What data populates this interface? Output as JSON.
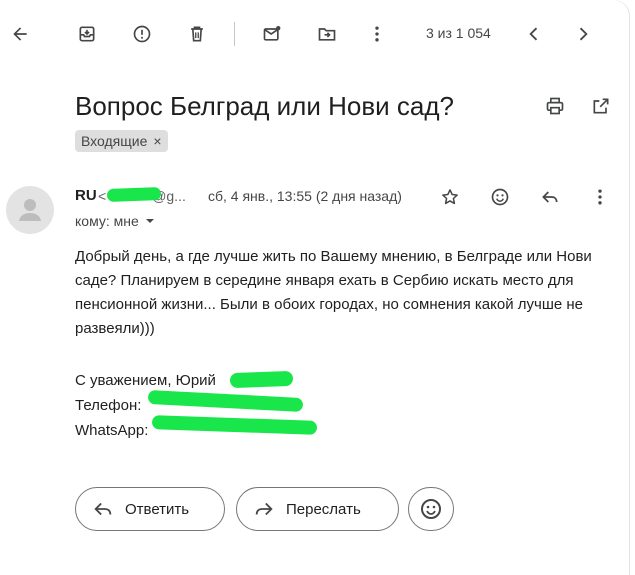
{
  "toolbar": {
    "pager_text": "3 из 1 054"
  },
  "message": {
    "subject": "Вопрос Белград или Нови сад?",
    "label": "Входящие",
    "label_remove": "×",
    "sender_name": "RU",
    "sender_email_fragment_start": "<",
    "sender_email_fragment_end": "@g...",
    "date": "сб, 4 янв., 13:55 (2 дня назад)",
    "to_line": "кому: мне",
    "body_paragraph": "Добрый день, а где лучше жить по Вашему мнению, в Белграде или Нови саде? Планируем в середине января ехать в Сербию искать место для пенсионной жизни... Были в обоих городах, но сомнения какой лучше не развеяли)))",
    "signature": {
      "line1": "С уважением, Юрий",
      "line2": "Телефон:",
      "line3": "WhatsApp:"
    }
  },
  "actions": {
    "reply_label": "Ответить",
    "forward_label": "Переслать"
  },
  "colors": {
    "redaction": "#19e64a",
    "icon": "#444746",
    "border": "#747775"
  }
}
